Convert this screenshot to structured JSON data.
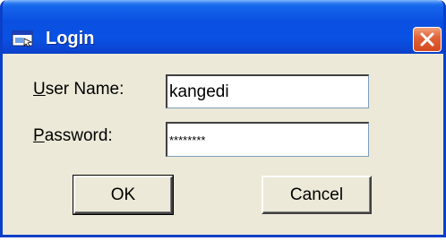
{
  "window": {
    "title": "Login",
    "close_symbol": "✕"
  },
  "form": {
    "username_label_mnemonic": "U",
    "username_label_rest": "ser Name:",
    "username_value": "kangedi",
    "password_label_mnemonic": "P",
    "password_label_rest": "assword:",
    "password_value": "********"
  },
  "buttons": {
    "ok_label": "OK",
    "cancel_label": "Cancel"
  },
  "colors": {
    "titlebar": "#0a4fe0",
    "close_button": "#d44a1f",
    "window_face": "#ece9d8"
  }
}
